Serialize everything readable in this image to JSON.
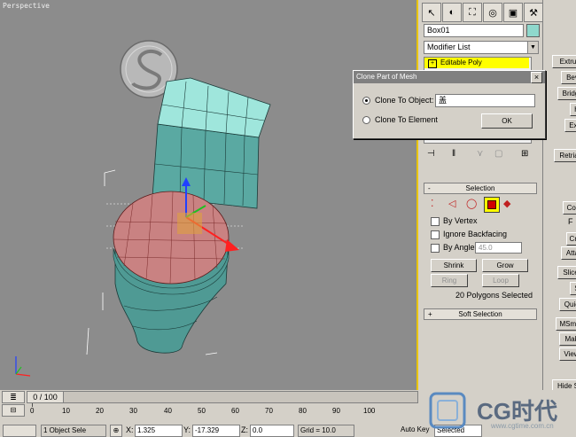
{
  "viewport": {
    "label": "Perspective"
  },
  "panel": {
    "object_name": "Box01",
    "object_color": "#8fd8cc",
    "modifier_list": "Modifier List",
    "stack_item": "Editable Poly",
    "selection_title": "Selection",
    "by_vertex": "By Vertex",
    "ignore_backfacing": "Ignore Backfacing",
    "by_angle": "By Angle:",
    "angle_value": "45.0",
    "shrink": "Shrink",
    "grow": "Grow",
    "ring": "Ring",
    "loop": "Loop",
    "selected_count": "20 Polygons Selected",
    "soft_selection": "Soft Selection"
  },
  "right_panel": {
    "items": [
      "Extru",
      "Bev",
      "Bridg",
      "H",
      "Ext",
      "Retria",
      "Con",
      "F",
      "Cre",
      "Atta",
      "Slice",
      "S",
      "Quic",
      "MSmo",
      "Mak",
      "View",
      "Hide S"
    ]
  },
  "dialog": {
    "title": "Clone Part of Mesh",
    "option_object": "Clone To Object:",
    "object_value": "盖",
    "option_element": "Clone To Element",
    "ok": "OK"
  },
  "timeline": {
    "counter": "0 / 100",
    "ticks": [
      "0",
      "10",
      "20",
      "30",
      "40",
      "50",
      "60",
      "70",
      "80",
      "90",
      "100"
    ]
  },
  "status": {
    "selection": "1 Object Sele",
    "x_label": "X:",
    "x_value": "1.325",
    "y_label": "Y:",
    "y_value": "-17.329",
    "z_label": "Z:",
    "z_value": "0.0",
    "grid": "Grid = 10.0",
    "autokey": "Auto Key",
    "selected": "Selected"
  },
  "watermark": {
    "brand": "CG时代",
    "url": "www.cgtime.com.cn"
  }
}
